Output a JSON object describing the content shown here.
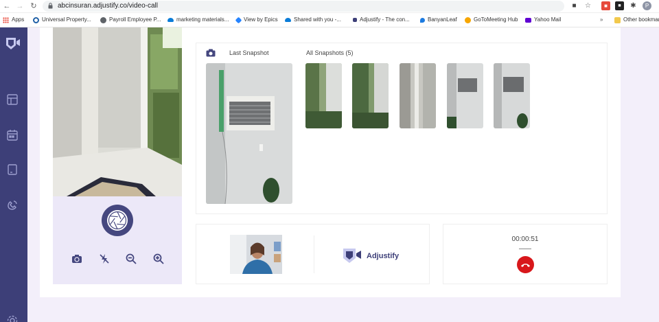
{
  "browser": {
    "url": "abcinsuran.adjustify.co/video-call",
    "profile_initial": "P"
  },
  "bookmarks": {
    "items": [
      {
        "label": "Apps",
        "icon": "grid-icon",
        "color": "#4285f4"
      },
      {
        "label": "Universal Property...",
        "icon": "ring-icon",
        "color": "#1f5fa6"
      },
      {
        "label": "Payroll Employee P...",
        "icon": "globe-icon",
        "color": "#5f6368"
      },
      {
        "label": "marketing materials...",
        "icon": "cloud-icon",
        "color": "#0a7cd8"
      },
      {
        "label": "View by Epics",
        "icon": "jira-icon",
        "color": "#2684ff"
      },
      {
        "label": "Shared with you -...",
        "icon": "cloud-icon",
        "color": "#0a7cd8"
      },
      {
        "label": "Adjustify - The con...",
        "icon": "adjustify-icon",
        "color": "#3d3f78"
      },
      {
        "label": "BanyanLeaf",
        "icon": "drop-icon",
        "color": "#1d7be0"
      },
      {
        "label": "GoToMeeting Hub",
        "icon": "flower-icon",
        "color": "#f7a600"
      },
      {
        "label": "Yahoo Mail",
        "icon": "mail-icon",
        "color": "#6001d2"
      }
    ],
    "overflow_label": "»",
    "other_label": "Other bookmarks"
  },
  "sidebar": {
    "items": [
      {
        "icon": "table-icon"
      },
      {
        "icon": "calendar-icon"
      },
      {
        "icon": "document-icon"
      },
      {
        "icon": "phone-icon"
      }
    ]
  },
  "snapshots": {
    "last_label": "Last Snapshot",
    "all_label": "All Snapshots (5)",
    "count": 5
  },
  "call": {
    "brand_name": "Adjustify",
    "timer": "00:00:51"
  },
  "colors": {
    "brand": "#3d3f78",
    "accent": "#45477f",
    "end_call": "#d8171b",
    "background": "#f3effa"
  }
}
